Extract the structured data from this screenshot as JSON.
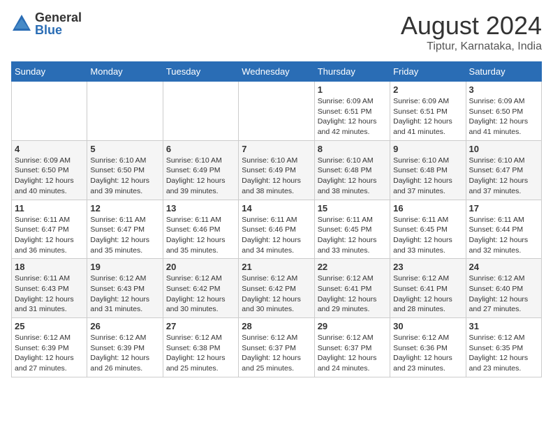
{
  "logo": {
    "general": "General",
    "blue": "Blue"
  },
  "title": {
    "month_year": "August 2024",
    "location": "Tiptur, Karnataka, India"
  },
  "days_of_week": [
    "Sunday",
    "Monday",
    "Tuesday",
    "Wednesday",
    "Thursday",
    "Friday",
    "Saturday"
  ],
  "weeks": [
    [
      {
        "day": "",
        "info": ""
      },
      {
        "day": "",
        "info": ""
      },
      {
        "day": "",
        "info": ""
      },
      {
        "day": "",
        "info": ""
      },
      {
        "day": "1",
        "info": "Sunrise: 6:09 AM\nSunset: 6:51 PM\nDaylight: 12 hours and 42 minutes."
      },
      {
        "day": "2",
        "info": "Sunrise: 6:09 AM\nSunset: 6:51 PM\nDaylight: 12 hours and 41 minutes."
      },
      {
        "day": "3",
        "info": "Sunrise: 6:09 AM\nSunset: 6:50 PM\nDaylight: 12 hours and 41 minutes."
      }
    ],
    [
      {
        "day": "4",
        "info": "Sunrise: 6:09 AM\nSunset: 6:50 PM\nDaylight: 12 hours and 40 minutes."
      },
      {
        "day": "5",
        "info": "Sunrise: 6:10 AM\nSunset: 6:50 PM\nDaylight: 12 hours and 39 minutes."
      },
      {
        "day": "6",
        "info": "Sunrise: 6:10 AM\nSunset: 6:49 PM\nDaylight: 12 hours and 39 minutes."
      },
      {
        "day": "7",
        "info": "Sunrise: 6:10 AM\nSunset: 6:49 PM\nDaylight: 12 hours and 38 minutes."
      },
      {
        "day": "8",
        "info": "Sunrise: 6:10 AM\nSunset: 6:48 PM\nDaylight: 12 hours and 38 minutes."
      },
      {
        "day": "9",
        "info": "Sunrise: 6:10 AM\nSunset: 6:48 PM\nDaylight: 12 hours and 37 minutes."
      },
      {
        "day": "10",
        "info": "Sunrise: 6:10 AM\nSunset: 6:47 PM\nDaylight: 12 hours and 37 minutes."
      }
    ],
    [
      {
        "day": "11",
        "info": "Sunrise: 6:11 AM\nSunset: 6:47 PM\nDaylight: 12 hours and 36 minutes."
      },
      {
        "day": "12",
        "info": "Sunrise: 6:11 AM\nSunset: 6:47 PM\nDaylight: 12 hours and 35 minutes."
      },
      {
        "day": "13",
        "info": "Sunrise: 6:11 AM\nSunset: 6:46 PM\nDaylight: 12 hours and 35 minutes."
      },
      {
        "day": "14",
        "info": "Sunrise: 6:11 AM\nSunset: 6:46 PM\nDaylight: 12 hours and 34 minutes."
      },
      {
        "day": "15",
        "info": "Sunrise: 6:11 AM\nSunset: 6:45 PM\nDaylight: 12 hours and 33 minutes."
      },
      {
        "day": "16",
        "info": "Sunrise: 6:11 AM\nSunset: 6:45 PM\nDaylight: 12 hours and 33 minutes."
      },
      {
        "day": "17",
        "info": "Sunrise: 6:11 AM\nSunset: 6:44 PM\nDaylight: 12 hours and 32 minutes."
      }
    ],
    [
      {
        "day": "18",
        "info": "Sunrise: 6:11 AM\nSunset: 6:43 PM\nDaylight: 12 hours and 31 minutes."
      },
      {
        "day": "19",
        "info": "Sunrise: 6:12 AM\nSunset: 6:43 PM\nDaylight: 12 hours and 31 minutes."
      },
      {
        "day": "20",
        "info": "Sunrise: 6:12 AM\nSunset: 6:42 PM\nDaylight: 12 hours and 30 minutes."
      },
      {
        "day": "21",
        "info": "Sunrise: 6:12 AM\nSunset: 6:42 PM\nDaylight: 12 hours and 30 minutes."
      },
      {
        "day": "22",
        "info": "Sunrise: 6:12 AM\nSunset: 6:41 PM\nDaylight: 12 hours and 29 minutes."
      },
      {
        "day": "23",
        "info": "Sunrise: 6:12 AM\nSunset: 6:41 PM\nDaylight: 12 hours and 28 minutes."
      },
      {
        "day": "24",
        "info": "Sunrise: 6:12 AM\nSunset: 6:40 PM\nDaylight: 12 hours and 27 minutes."
      }
    ],
    [
      {
        "day": "25",
        "info": "Sunrise: 6:12 AM\nSunset: 6:39 PM\nDaylight: 12 hours and 27 minutes."
      },
      {
        "day": "26",
        "info": "Sunrise: 6:12 AM\nSunset: 6:39 PM\nDaylight: 12 hours and 26 minutes."
      },
      {
        "day": "27",
        "info": "Sunrise: 6:12 AM\nSunset: 6:38 PM\nDaylight: 12 hours and 25 minutes."
      },
      {
        "day": "28",
        "info": "Sunrise: 6:12 AM\nSunset: 6:37 PM\nDaylight: 12 hours and 25 minutes."
      },
      {
        "day": "29",
        "info": "Sunrise: 6:12 AM\nSunset: 6:37 PM\nDaylight: 12 hours and 24 minutes."
      },
      {
        "day": "30",
        "info": "Sunrise: 6:12 AM\nSunset: 6:36 PM\nDaylight: 12 hours and 23 minutes."
      },
      {
        "day": "31",
        "info": "Sunrise: 6:12 AM\nSunset: 6:35 PM\nDaylight: 12 hours and 23 minutes."
      }
    ]
  ]
}
